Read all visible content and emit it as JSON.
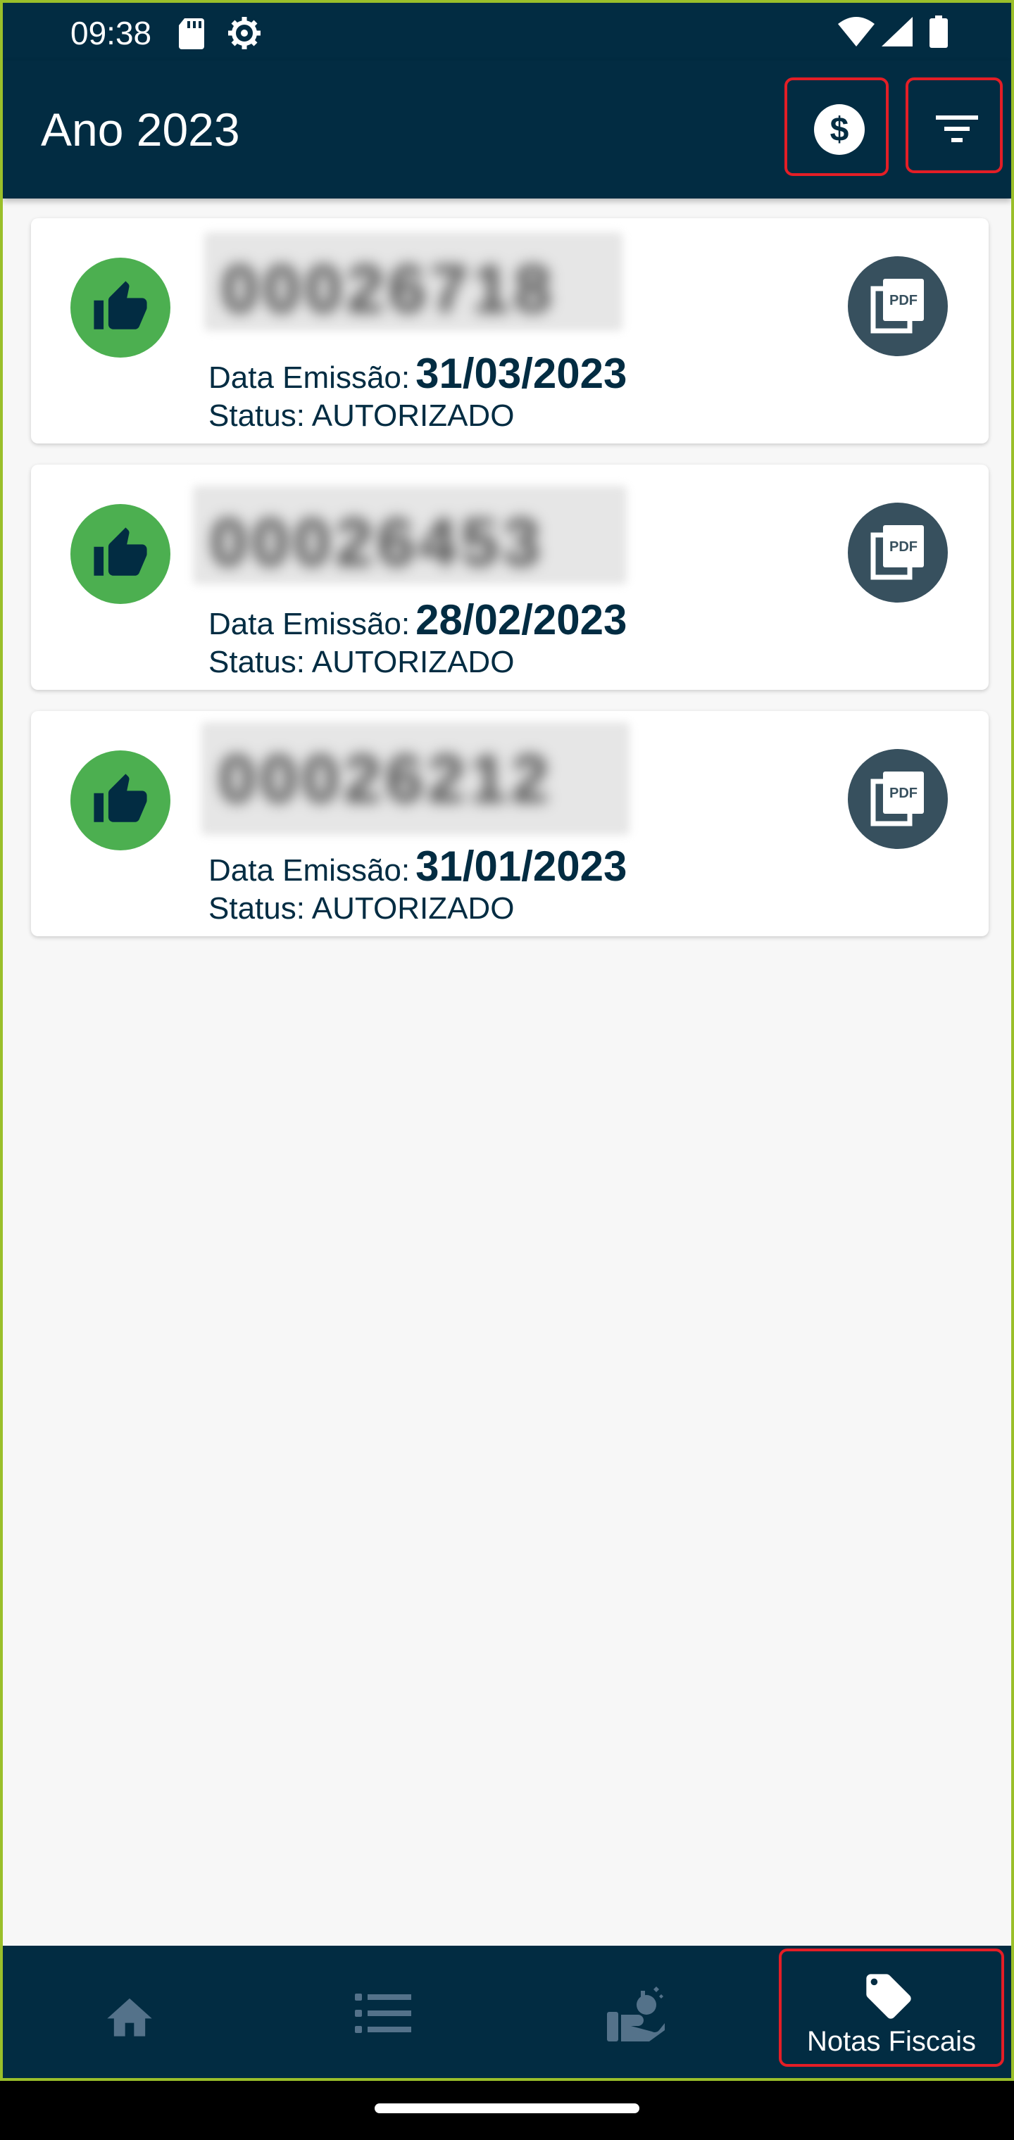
{
  "status_bar": {
    "time": "09:38"
  },
  "app_bar": {
    "title": "Ano 2023"
  },
  "invoices": [
    {
      "number": "00026718",
      "date_label": "Data Emissão:",
      "date": "31/03/2023",
      "status_label": "Status:",
      "status": "AUTORIZADO",
      "pdf_label": "PDF"
    },
    {
      "number": "00026453",
      "date_label": "Data Emissão:",
      "date": "28/02/2023",
      "status_label": "Status:",
      "status": "AUTORIZADO",
      "pdf_label": "PDF"
    },
    {
      "number": "00026212",
      "date_label": "Data Emissão:",
      "date": "31/01/2023",
      "status_label": "Status:",
      "status": "AUTORIZADO",
      "pdf_label": "PDF"
    }
  ],
  "bottom_nav": {
    "items": [
      {
        "icon": "home-icon"
      },
      {
        "icon": "list-icon"
      },
      {
        "icon": "service-icon"
      },
      {
        "icon": "tag-icon",
        "label": "Notas Fiscais",
        "selected": true
      }
    ]
  },
  "colors": {
    "primary": "#022c42",
    "success": "#4caf50",
    "pdf_circle": "#37505e",
    "highlight": "#e41e26"
  }
}
